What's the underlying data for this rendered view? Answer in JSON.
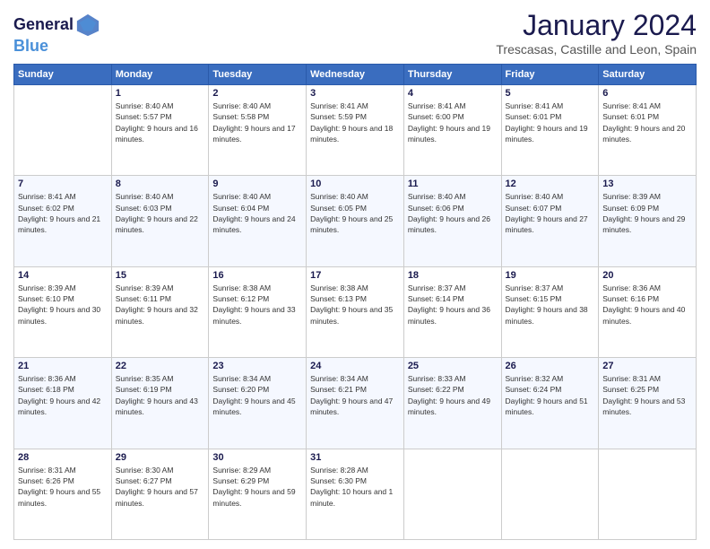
{
  "header": {
    "logo_line1": "General",
    "logo_line2": "Blue",
    "month_title": "January 2024",
    "location": "Trescasas, Castille and Leon, Spain"
  },
  "weekdays": [
    "Sunday",
    "Monday",
    "Tuesday",
    "Wednesday",
    "Thursday",
    "Friday",
    "Saturday"
  ],
  "weeks": [
    [
      {
        "day": "",
        "sunrise": "",
        "sunset": "",
        "daylight": ""
      },
      {
        "day": "1",
        "sunrise": "Sunrise: 8:40 AM",
        "sunset": "Sunset: 5:57 PM",
        "daylight": "Daylight: 9 hours and 16 minutes."
      },
      {
        "day": "2",
        "sunrise": "Sunrise: 8:40 AM",
        "sunset": "Sunset: 5:58 PM",
        "daylight": "Daylight: 9 hours and 17 minutes."
      },
      {
        "day": "3",
        "sunrise": "Sunrise: 8:41 AM",
        "sunset": "Sunset: 5:59 PM",
        "daylight": "Daylight: 9 hours and 18 minutes."
      },
      {
        "day": "4",
        "sunrise": "Sunrise: 8:41 AM",
        "sunset": "Sunset: 6:00 PM",
        "daylight": "Daylight: 9 hours and 19 minutes."
      },
      {
        "day": "5",
        "sunrise": "Sunrise: 8:41 AM",
        "sunset": "Sunset: 6:01 PM",
        "daylight": "Daylight: 9 hours and 19 minutes."
      },
      {
        "day": "6",
        "sunrise": "Sunrise: 8:41 AM",
        "sunset": "Sunset: 6:01 PM",
        "daylight": "Daylight: 9 hours and 20 minutes."
      }
    ],
    [
      {
        "day": "7",
        "sunrise": "Sunrise: 8:41 AM",
        "sunset": "Sunset: 6:02 PM",
        "daylight": "Daylight: 9 hours and 21 minutes."
      },
      {
        "day": "8",
        "sunrise": "Sunrise: 8:40 AM",
        "sunset": "Sunset: 6:03 PM",
        "daylight": "Daylight: 9 hours and 22 minutes."
      },
      {
        "day": "9",
        "sunrise": "Sunrise: 8:40 AM",
        "sunset": "Sunset: 6:04 PM",
        "daylight": "Daylight: 9 hours and 24 minutes."
      },
      {
        "day": "10",
        "sunrise": "Sunrise: 8:40 AM",
        "sunset": "Sunset: 6:05 PM",
        "daylight": "Daylight: 9 hours and 25 minutes."
      },
      {
        "day": "11",
        "sunrise": "Sunrise: 8:40 AM",
        "sunset": "Sunset: 6:06 PM",
        "daylight": "Daylight: 9 hours and 26 minutes."
      },
      {
        "day": "12",
        "sunrise": "Sunrise: 8:40 AM",
        "sunset": "Sunset: 6:07 PM",
        "daylight": "Daylight: 9 hours and 27 minutes."
      },
      {
        "day": "13",
        "sunrise": "Sunrise: 8:39 AM",
        "sunset": "Sunset: 6:09 PM",
        "daylight": "Daylight: 9 hours and 29 minutes."
      }
    ],
    [
      {
        "day": "14",
        "sunrise": "Sunrise: 8:39 AM",
        "sunset": "Sunset: 6:10 PM",
        "daylight": "Daylight: 9 hours and 30 minutes."
      },
      {
        "day": "15",
        "sunrise": "Sunrise: 8:39 AM",
        "sunset": "Sunset: 6:11 PM",
        "daylight": "Daylight: 9 hours and 32 minutes."
      },
      {
        "day": "16",
        "sunrise": "Sunrise: 8:38 AM",
        "sunset": "Sunset: 6:12 PM",
        "daylight": "Daylight: 9 hours and 33 minutes."
      },
      {
        "day": "17",
        "sunrise": "Sunrise: 8:38 AM",
        "sunset": "Sunset: 6:13 PM",
        "daylight": "Daylight: 9 hours and 35 minutes."
      },
      {
        "day": "18",
        "sunrise": "Sunrise: 8:37 AM",
        "sunset": "Sunset: 6:14 PM",
        "daylight": "Daylight: 9 hours and 36 minutes."
      },
      {
        "day": "19",
        "sunrise": "Sunrise: 8:37 AM",
        "sunset": "Sunset: 6:15 PM",
        "daylight": "Daylight: 9 hours and 38 minutes."
      },
      {
        "day": "20",
        "sunrise": "Sunrise: 8:36 AM",
        "sunset": "Sunset: 6:16 PM",
        "daylight": "Daylight: 9 hours and 40 minutes."
      }
    ],
    [
      {
        "day": "21",
        "sunrise": "Sunrise: 8:36 AM",
        "sunset": "Sunset: 6:18 PM",
        "daylight": "Daylight: 9 hours and 42 minutes."
      },
      {
        "day": "22",
        "sunrise": "Sunrise: 8:35 AM",
        "sunset": "Sunset: 6:19 PM",
        "daylight": "Daylight: 9 hours and 43 minutes."
      },
      {
        "day": "23",
        "sunrise": "Sunrise: 8:34 AM",
        "sunset": "Sunset: 6:20 PM",
        "daylight": "Daylight: 9 hours and 45 minutes."
      },
      {
        "day": "24",
        "sunrise": "Sunrise: 8:34 AM",
        "sunset": "Sunset: 6:21 PM",
        "daylight": "Daylight: 9 hours and 47 minutes."
      },
      {
        "day": "25",
        "sunrise": "Sunrise: 8:33 AM",
        "sunset": "Sunset: 6:22 PM",
        "daylight": "Daylight: 9 hours and 49 minutes."
      },
      {
        "day": "26",
        "sunrise": "Sunrise: 8:32 AM",
        "sunset": "Sunset: 6:24 PM",
        "daylight": "Daylight: 9 hours and 51 minutes."
      },
      {
        "day": "27",
        "sunrise": "Sunrise: 8:31 AM",
        "sunset": "Sunset: 6:25 PM",
        "daylight": "Daylight: 9 hours and 53 minutes."
      }
    ],
    [
      {
        "day": "28",
        "sunrise": "Sunrise: 8:31 AM",
        "sunset": "Sunset: 6:26 PM",
        "daylight": "Daylight: 9 hours and 55 minutes."
      },
      {
        "day": "29",
        "sunrise": "Sunrise: 8:30 AM",
        "sunset": "Sunset: 6:27 PM",
        "daylight": "Daylight: 9 hours and 57 minutes."
      },
      {
        "day": "30",
        "sunrise": "Sunrise: 8:29 AM",
        "sunset": "Sunset: 6:29 PM",
        "daylight": "Daylight: 9 hours and 59 minutes."
      },
      {
        "day": "31",
        "sunrise": "Sunrise: 8:28 AM",
        "sunset": "Sunset: 6:30 PM",
        "daylight": "Daylight: 10 hours and 1 minute."
      },
      {
        "day": "",
        "sunrise": "",
        "sunset": "",
        "daylight": ""
      },
      {
        "day": "",
        "sunrise": "",
        "sunset": "",
        "daylight": ""
      },
      {
        "day": "",
        "sunrise": "",
        "sunset": "",
        "daylight": ""
      }
    ]
  ]
}
